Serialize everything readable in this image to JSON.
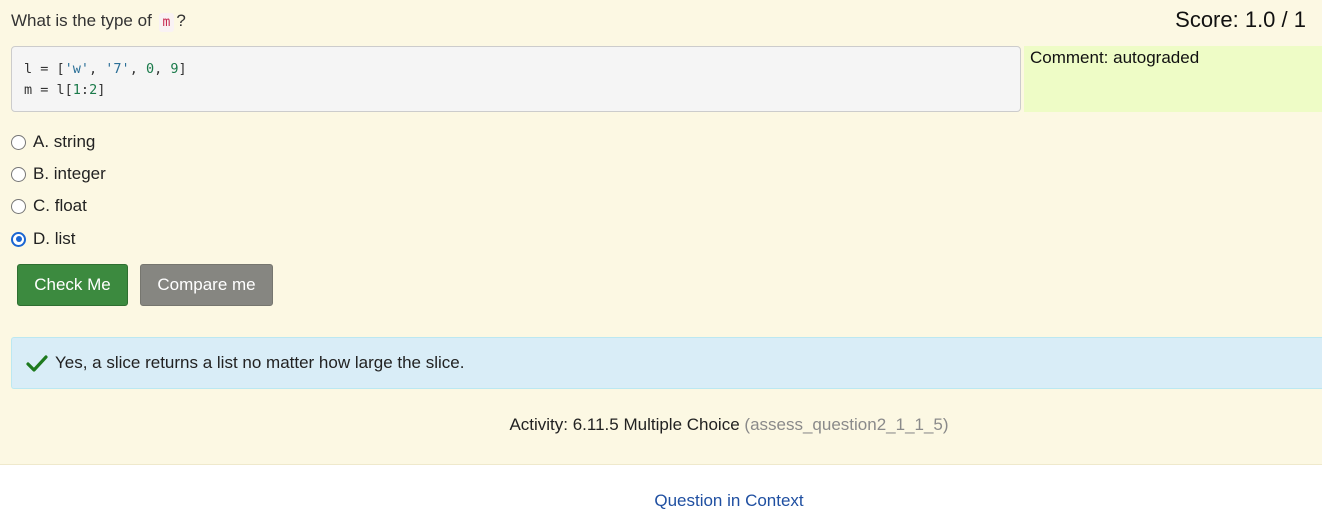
{
  "question": {
    "prefix": "What is the type of",
    "code": "m",
    "suffix": "?"
  },
  "score": "Score: 1.0 / 1",
  "code_lines": {
    "line1": {
      "a": "l = [",
      "s1": "'w'",
      "c1": ", ",
      "s2": "'7'",
      "c2": ", ",
      "n1": "0",
      "c3": ", ",
      "n2": "9",
      "end": "]"
    },
    "line2": {
      "a": "m = l[",
      "n1": "1",
      "c1": ":",
      "n2": "2",
      "end": "]"
    }
  },
  "comment": "Comment: autograded",
  "choices": [
    {
      "label": "A. string",
      "checked": false
    },
    {
      "label": "B. integer",
      "checked": false
    },
    {
      "label": "C. float",
      "checked": false
    },
    {
      "label": "D. list",
      "checked": true
    }
  ],
  "buttons": {
    "check": "Check Me",
    "compare": "Compare me"
  },
  "feedback": {
    "text": "Yes, a slice returns a list no matter how large the slice.",
    "icon": "checkmark-icon",
    "color": "#1e7a1e"
  },
  "activity": {
    "label": "Activity: 6.11.5 Multiple Choice",
    "id": "(assess_question2_1_1_5)"
  },
  "context_link": "Question in Context",
  "colors": {
    "panel_bg": "#fcf8e3",
    "accent_green": "#3c8a3f",
    "info_bg": "#d9edf7",
    "link": "#1f4fa1"
  }
}
